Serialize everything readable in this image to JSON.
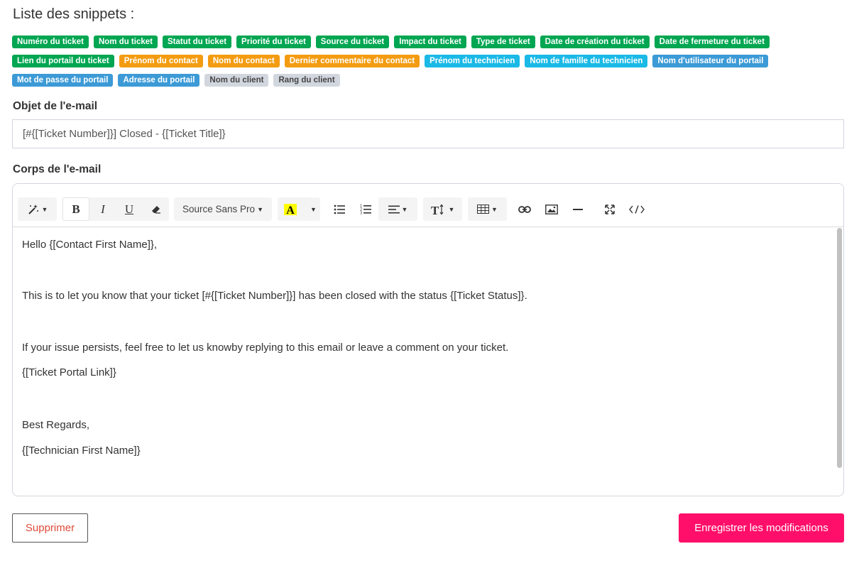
{
  "snippets": {
    "title": "Liste des snippets :",
    "row1": [
      "Numéro du ticket",
      "Nom du ticket",
      "Statut du ticket",
      "Priorité du ticket",
      "Source du ticket",
      "Impact du ticket",
      "Type de ticket",
      "Date de création du ticket",
      "Date de fermeture du ticket"
    ],
    "row2": [
      "Lien du portail du ticket",
      "Prénom du contact",
      "Nom du contact",
      "Dernier commentaire du contact",
      "Prénom du technicien",
      "Nom de famille du technicien",
      "Nom d'utilisateur du portail"
    ],
    "row3": [
      "Mot de passe du portail",
      "Adresse du portail",
      "Nom du client",
      "Rang du client"
    ],
    "colors": {
      "green": "#00a651",
      "orange": "#f39c12",
      "cyan": "#1ab9e6",
      "blue": "#3c9ad6",
      "gray": "#d2d6de"
    }
  },
  "subject": {
    "label": "Objet de l'e-mail",
    "value": "[#{[Ticket Number]}] Closed - {[Ticket Title]}"
  },
  "body": {
    "label": "Corps de l'e-mail",
    "font": "Source Sans Pro",
    "toolbar_icons": [
      "magic-icon",
      "bold-icon",
      "italic-icon",
      "underline-icon",
      "eraser-icon",
      "font-family-select",
      "highlight-icon",
      "unordered-list-icon",
      "ordered-list-icon",
      "align-icon",
      "font-size-icon",
      "table-icon",
      "link-icon",
      "image-icon",
      "hr-icon",
      "fullscreen-icon",
      "code-view-icon"
    ],
    "lines": [
      "Hello {[Contact First Name]},",
      "This is to let you know that your ticket [#{[Ticket Number]}] has been closed with the status {[Ticket Status]}.",
      "If your issue persists, feel free to let us knowby replying to this email or leave a comment on your ticket.",
      "{[Ticket Portal Link]}",
      "Best Regards,",
      "{[Technician First Name]}"
    ]
  },
  "actions": {
    "delete_label": "Supprimer",
    "save_label": "Enregistrer les modifications",
    "save_color": "#ff0f6a",
    "delete_color": "#dd4b39"
  }
}
